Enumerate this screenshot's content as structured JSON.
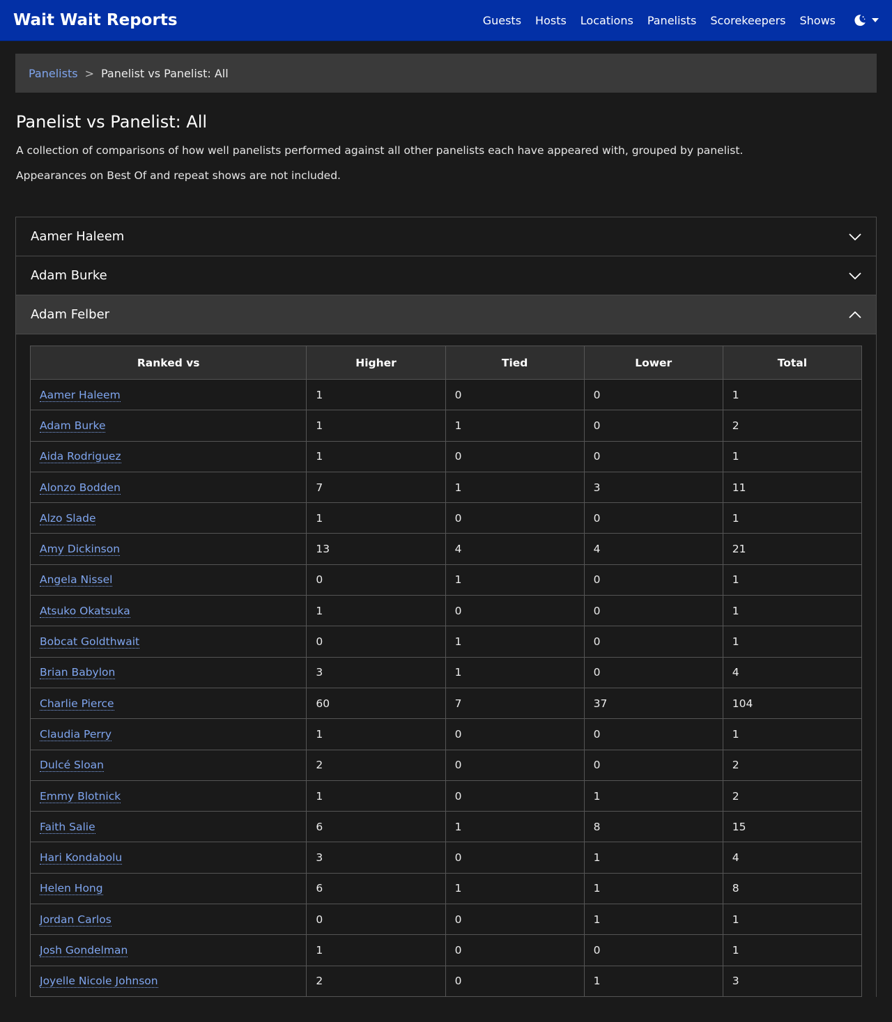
{
  "navbar": {
    "brand": "Wait Wait Reports",
    "links": [
      "Guests",
      "Hosts",
      "Locations",
      "Panelists",
      "Scorekeepers",
      "Shows"
    ],
    "theme_icon": "moon-icon"
  },
  "breadcrumb": {
    "parent": "Panelists",
    "separator": ">",
    "current": "Panelist vs Panelist: All"
  },
  "page": {
    "title": "Panelist vs Panelist: All",
    "description": "A collection of comparisons of how well panelists performed against all other panelists each have appeared with, grouped by panelist.",
    "note": "Appearances on Best Of and repeat shows are not included."
  },
  "accordion": {
    "items": [
      {
        "name": "Aamer Haleem",
        "expanded": false
      },
      {
        "name": "Adam Burke",
        "expanded": false
      },
      {
        "name": "Adam Felber",
        "expanded": true
      }
    ]
  },
  "table": {
    "headers": [
      "Ranked vs",
      "Higher",
      "Tied",
      "Lower",
      "Total"
    ],
    "rows": [
      {
        "name": "Aamer Haleem",
        "higher": "1",
        "tied": "0",
        "lower": "0",
        "total": "1"
      },
      {
        "name": "Adam Burke",
        "higher": "1",
        "tied": "1",
        "lower": "0",
        "total": "2"
      },
      {
        "name": "Aida Rodriguez",
        "higher": "1",
        "tied": "0",
        "lower": "0",
        "total": "1"
      },
      {
        "name": "Alonzo Bodden",
        "higher": "7",
        "tied": "1",
        "lower": "3",
        "total": "11"
      },
      {
        "name": "Alzo Slade",
        "higher": "1",
        "tied": "0",
        "lower": "0",
        "total": "1"
      },
      {
        "name": "Amy Dickinson",
        "higher": "13",
        "tied": "4",
        "lower": "4",
        "total": "21"
      },
      {
        "name": "Angela Nissel",
        "higher": "0",
        "tied": "1",
        "lower": "0",
        "total": "1"
      },
      {
        "name": "Atsuko Okatsuka",
        "higher": "1",
        "tied": "0",
        "lower": "0",
        "total": "1"
      },
      {
        "name": "Bobcat Goldthwait",
        "higher": "0",
        "tied": "1",
        "lower": "0",
        "total": "1"
      },
      {
        "name": "Brian Babylon",
        "higher": "3",
        "tied": "1",
        "lower": "0",
        "total": "4"
      },
      {
        "name": "Charlie Pierce",
        "higher": "60",
        "tied": "7",
        "lower": "37",
        "total": "104"
      },
      {
        "name": "Claudia Perry",
        "higher": "1",
        "tied": "0",
        "lower": "0",
        "total": "1"
      },
      {
        "name": "Dulcé Sloan",
        "higher": "2",
        "tied": "0",
        "lower": "0",
        "total": "2"
      },
      {
        "name": "Emmy Blotnick",
        "higher": "1",
        "tied": "0",
        "lower": "1",
        "total": "2"
      },
      {
        "name": "Faith Salie",
        "higher": "6",
        "tied": "1",
        "lower": "8",
        "total": "15"
      },
      {
        "name": "Hari Kondabolu",
        "higher": "3",
        "tied": "0",
        "lower": "1",
        "total": "4"
      },
      {
        "name": "Helen Hong",
        "higher": "6",
        "tied": "1",
        "lower": "1",
        "total": "8"
      },
      {
        "name": "Jordan Carlos",
        "higher": "0",
        "tied": "0",
        "lower": "1",
        "total": "1"
      },
      {
        "name": "Josh Gondelman",
        "higher": "1",
        "tied": "0",
        "lower": "0",
        "total": "1"
      },
      {
        "name": "Joyelle Nicole Johnson",
        "higher": "2",
        "tied": "0",
        "lower": "1",
        "total": "3"
      }
    ]
  }
}
